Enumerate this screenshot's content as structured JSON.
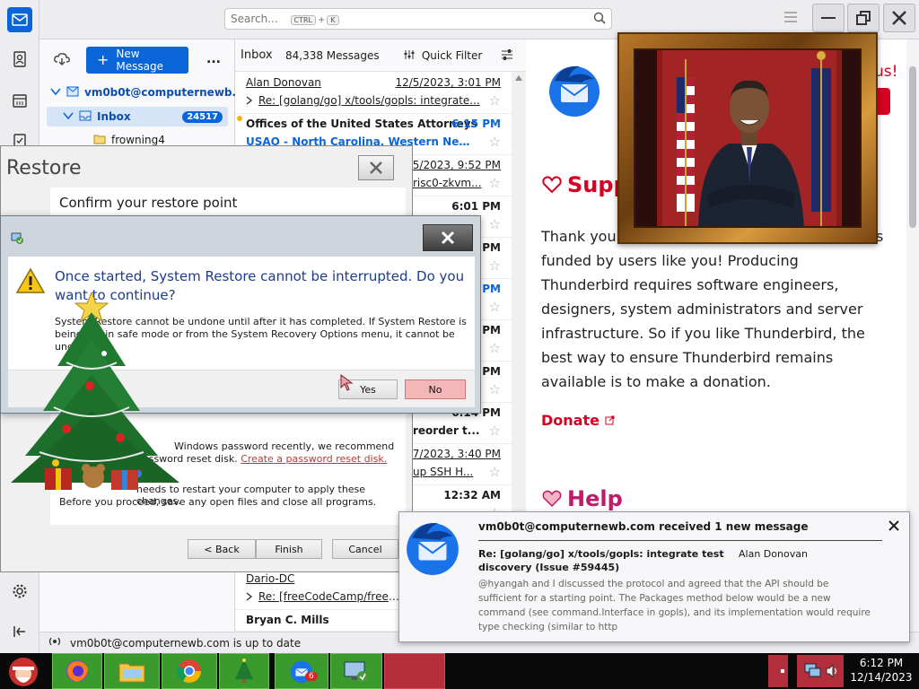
{
  "thunderbird": {
    "search_placeholder": "Search...",
    "kbd_ctrl": "CTRL",
    "kbd_plus": "+",
    "kbd_k": "K",
    "new_message": "New Message",
    "more": "...",
    "account": "vm0b0t@computernewb....",
    "inbox_label": "Inbox",
    "inbox_count": "24517",
    "subfolder": "frowning4",
    "status": "vm0b0t@computernewb.com is up to date"
  },
  "list": {
    "title": "Inbox",
    "count": "84,338 Messages",
    "quick_filter": "Quick Filter",
    "rows": [
      {
        "from": "Alan Donovan",
        "date": "12/5/2023, 3:01 PM",
        "subject": "Re: [golang/go] x/tools/gopls: integrate..."
      },
      {
        "from": "Offices of the United States Attorneys",
        "date": "6:15 PM",
        "subject": "USAO - North Carolina, Western News ..."
      },
      {
        "from": "",
        "date": "12/5/2023, 9:52 PM",
        "subject": "risc0-zkvm..."
      },
      {
        "from": "",
        "date": "6:01 PM",
        "subject": ""
      },
      {
        "from": "",
        "date": "PM",
        "subject": ""
      },
      {
        "from": "",
        "date": "PM",
        "subject": ""
      },
      {
        "from": "",
        "date": "PM",
        "subject": ""
      },
      {
        "from": "",
        "date": "PM",
        "subject": ""
      },
      {
        "from": "",
        "date": "6:14 PM",
        "subject": "reorder t..."
      },
      {
        "from": "",
        "date": "12/7/2023, 3:40 PM",
        "subject": "up SSH H..."
      },
      {
        "from": "",
        "date": "12:32 AM",
        "subject": ""
      }
    ],
    "bottom_rows": [
      {
        "from": "Dario-DC",
        "subject": "Re: [freeCodeCamp/freeCo..."
      },
      {
        "from": "Bryan C. Mills",
        "subject": ""
      }
    ]
  },
  "reader": {
    "support_heading": "Supp",
    "body": "Thank you funded by users like you! Producing Thunderbird requires software engineers, designers, system administrators and server infrastructure. So if you like Thunderbird, the best way to ensure Thunderbird remains available is to make a donation.",
    "body_lines": [
      "Thank you",
      "funded by users like you! Producing",
      "Thunderbird requires software engineers,",
      "designers, system administrators and server",
      "infrastructure. So if you like Thunderbird, the",
      "best way to ensure Thunderbird remains",
      "available is to make a donation."
    ],
    "donate": "Donate",
    "help": "Help",
    "us_fragment": "us!",
    "s_fragment": "s"
  },
  "restore": {
    "title": "Restore",
    "confirm_heading": "Confirm your restore point",
    "pwd_text_1": "Windows password recently, we recommend",
    "pwd_text_2": "password reset disk.",
    "pwd_link": "Create a password reset disk.",
    "restart_text_1": "needs to restart your computer to apply these changes.",
    "restart_text_2": "Before you proceed, save any open files and close all programs.",
    "back": "< Back",
    "finish": "Finish",
    "cancel": "Cancel"
  },
  "confirm": {
    "question": "Once started, System Restore cannot be interrupted. Do you want to continue?",
    "detail_1": "System Restore cannot be undone until after it has completed. If System Restore is",
    "detail_2": "being run in safe mode or from the System Recovery Options menu, it cannot be",
    "detail_3": "undone.",
    "yes": "Yes",
    "no": "No"
  },
  "notification": {
    "title": "vm0b0t@computernewb.com received 1 new message",
    "subject": "Re: [golang/go] x/tools/gopls: integrate test discovery (Issue #59445)",
    "subject_line1": "Re: [golang/go] x/tools/gopls: integrate test",
    "subject_line2": "discovery (Issue #59445)",
    "sender": "Alan Donovan",
    "preview_lines": [
      "@hyangah and I discussed the protocol and agreed that the API should be",
      "sufficient for a starting point. The Packages method below would be a new",
      "command (see command.Interface in gopls), and its implementation would require",
      "type checking (similar to http"
    ]
  },
  "taskbar": {
    "time": "6:12 PM",
    "date": "12/14/2023",
    "badge": "6"
  },
  "colors": {
    "thunderbird_blue": "#0a66d8",
    "donate_red": "#d70022",
    "taskbar_green": "#3a9a2c",
    "no_button": "#f3b7b7"
  }
}
